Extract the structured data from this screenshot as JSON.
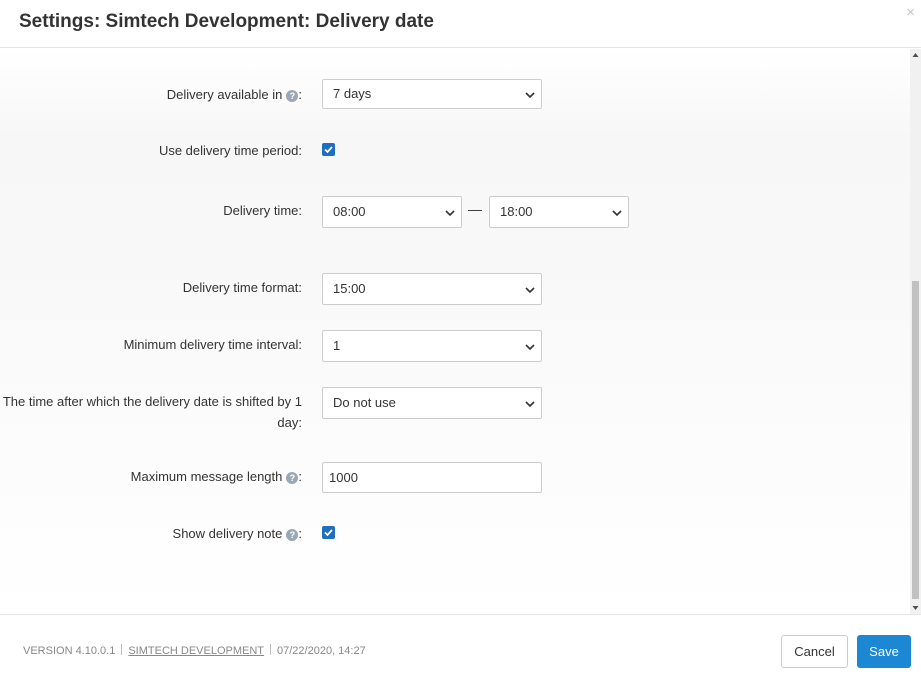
{
  "dialog": {
    "title": "Settings: Simtech Development: Delivery date",
    "close_glyph": "×"
  },
  "form": {
    "delivery_available_in": {
      "label": "Delivery available in",
      "suffix": ":",
      "help_icon": "question-circle-icon",
      "value": "7 days"
    },
    "use_delivery_time_period": {
      "label": "Use delivery time period:",
      "checked": true
    },
    "delivery_time": {
      "label": "Delivery time:",
      "from": "08:00",
      "separator": "—",
      "to": "18:00"
    },
    "delivery_time_format": {
      "label": "Delivery time format:",
      "value": "15:00"
    },
    "minimum_delivery_time_interval": {
      "label": "Minimum delivery time interval:",
      "value": "1"
    },
    "shift_time": {
      "label": "The time after which the delivery date is shifted by 1 day:",
      "value": "Do not use"
    },
    "maximum_message_length": {
      "label": "Maximum message length",
      "suffix": ":",
      "help_icon": "question-circle-icon",
      "value": "1000"
    },
    "show_delivery_note": {
      "label": "Show delivery note",
      "suffix": ":",
      "help_icon": "question-circle-icon",
      "checked": true
    }
  },
  "footer": {
    "version": "VERSION 4.10.0.1",
    "vendor_link": "SIMTECH DEVELOPMENT",
    "date": "07/22/2020, 14:27",
    "cancel_label": "Cancel",
    "save_label": "Save"
  },
  "colors": {
    "accent": "#1c88d4",
    "checkbox": "#1f6ec1",
    "help_icon": "#9aa8b6"
  }
}
